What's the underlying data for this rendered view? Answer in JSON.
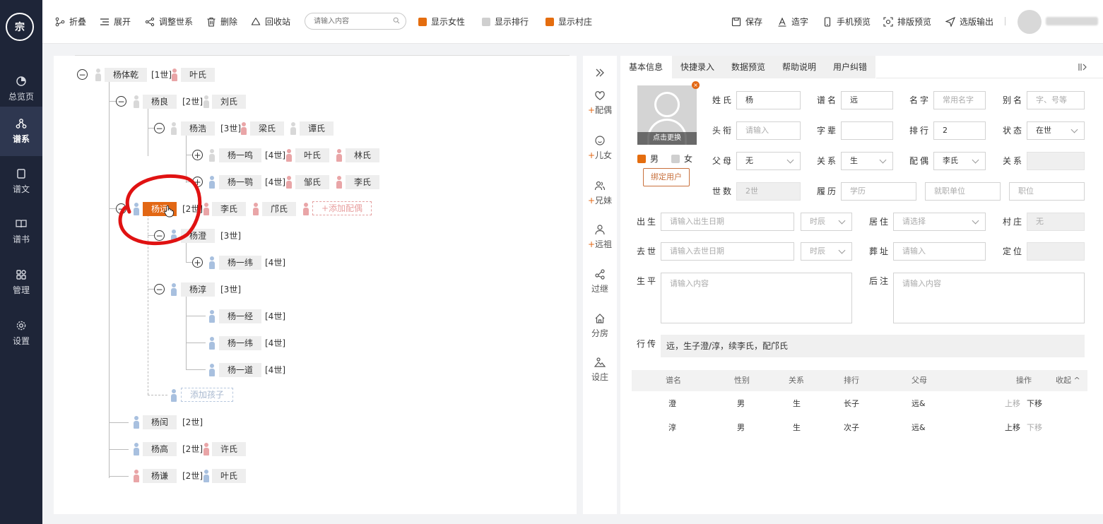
{
  "nav": {
    "logo": "宗",
    "items": [
      {
        "label": "总览页",
        "icon": "pie-icon"
      },
      {
        "label": "谱系",
        "icon": "hierarchy-icon",
        "active": true
      },
      {
        "label": "谱文",
        "icon": "doc-icon"
      },
      {
        "label": "谱书",
        "icon": "book-icon"
      },
      {
        "label": "管理",
        "icon": "grid-icon"
      },
      {
        "label": "设置",
        "icon": "gear-icon"
      }
    ]
  },
  "toolbar": {
    "collapse": "折叠",
    "expand": "展开",
    "adjust": "调整世系",
    "delete": "删除",
    "recycle": "回收站",
    "search_placeholder": "请输入内容",
    "show_female": "显示女性",
    "show_rank": "显示排行",
    "show_village": "显示村庄",
    "save": "保存",
    "make_char": "造字",
    "mobile_preview": "手机预览",
    "layout_preview": "排版预览",
    "select_output": "选版输出"
  },
  "tree": {
    "n1": {
      "name": "杨体乾",
      "gen": "[1世]",
      "spouse": "叶氏"
    },
    "n2a": {
      "name": "杨良",
      "gen": "[2世]",
      "spouse": "刘氏"
    },
    "n3a": {
      "name": "杨浩",
      "gen": "[3世]",
      "spouse1": "梁氏",
      "spouse2": "谭氏"
    },
    "n4a": {
      "name": "杨一鸣",
      "gen": "[4世]",
      "spouse1": "叶氏",
      "spouse2": "林氏"
    },
    "n4b": {
      "name": "杨一鹗",
      "gen": "[4世]",
      "spouse1": "邹氏",
      "spouse2": "李氏"
    },
    "n2b": {
      "name": "杨远",
      "gen": "[2世]",
      "spouse1": "李氏",
      "spouse2": "邝氏",
      "add_spouse": "+添加配偶"
    },
    "n3b": {
      "name": "杨澄",
      "gen": "[3世]"
    },
    "n4c": {
      "name": "杨一纬",
      "gen": "[4世]"
    },
    "n3c": {
      "name": "杨淳",
      "gen": "[3世]"
    },
    "n4d": {
      "name": "杨一经",
      "gen": "[4世]"
    },
    "n4e": {
      "name": "杨一纬",
      "gen": "[4世]"
    },
    "n4f": {
      "name": "杨一道",
      "gen": "[4世]"
    },
    "add_child": "添加孩子",
    "n2c": {
      "name": "杨闰",
      "gen": "[2世]"
    },
    "n2d": {
      "name": "杨高",
      "gen": "[2世]",
      "spouse": "许氏"
    },
    "n2e": {
      "name": "杨谦",
      "gen": "[2世]",
      "spouse": "叶氏"
    }
  },
  "actions": [
    {
      "plus": "+",
      "label": "配偶",
      "icon": "spouse-icon"
    },
    {
      "plus": "+",
      "label": "儿女",
      "icon": "child-icon"
    },
    {
      "plus": "+",
      "label": "兄妹",
      "icon": "siblings-icon"
    },
    {
      "plus": "+",
      "label": "远祖",
      "icon": "ancestor-icon"
    },
    {
      "plus": "",
      "label": "过继",
      "icon": "adopt-icon"
    },
    {
      "plus": "",
      "label": "分房",
      "icon": "house-icon"
    },
    {
      "plus": "",
      "label": "设庄",
      "icon": "village-icon"
    }
  ],
  "tabs": [
    "基本信息",
    "快捷录入",
    "数据预览",
    "帮助说明",
    "用户纠错"
  ],
  "form": {
    "photo_caption": "点击更换",
    "photo_remove": "×",
    "male": "男",
    "female": "女",
    "bind_user": "绑定用户",
    "surname_label": "姓氏",
    "surname": "杨",
    "puming_label": "谱名",
    "puming": "远",
    "mingzi_label": "名字",
    "mingzi_ph": "常用名字",
    "bieming_label": "别名",
    "bieming_ph": "字、号等",
    "touxian_label": "头衔",
    "touxian_ph": "请输入",
    "zibei_label": "字辈",
    "zibei": "",
    "paihang_label": "排行",
    "paihang": "2",
    "status_label": "状态",
    "status": "在世",
    "fumu_label": "父母",
    "fumu": "无",
    "guanxi_label": "关系",
    "guanxi": "生",
    "peiou_label": "配偶",
    "peiou": "李氏",
    "guanxi2_label": "关系",
    "guanxi2": "",
    "shishu_label": "世数",
    "shishu": "2世",
    "lvli_label": "履历",
    "lvli_ph": "学历",
    "danwei_ph": "就职单位",
    "zhiwei_ph": "职位",
    "birth_label": "出生",
    "birth_ph": "请输入出生日期",
    "birth_time": "时辰",
    "live_label": "居住",
    "live_ph": "请选择",
    "village_label": "村庄",
    "village": "无",
    "death_label": "去世",
    "death_ph": "请输入去世日期",
    "death_time": "时辰",
    "burial_label": "葬址",
    "burial_ph": "请输入",
    "locate_label": "定位",
    "locate": "",
    "life_label": "生平",
    "life_ph": "请输入内容",
    "note_label": "后注",
    "note_ph": "请输入内容",
    "bio_label": "行传",
    "bio": "远，生子澄/淳，续李氏，配邝氏"
  },
  "table": {
    "headers": [
      "谱名",
      "性别",
      "关系",
      "排行",
      "父母",
      "操作",
      "收起 ^"
    ],
    "rows": [
      {
        "name": "澄",
        "sex": "男",
        "rel": "生",
        "rank": "长子",
        "parent": "远&",
        "up": "上移",
        "down": "下移"
      },
      {
        "name": "淳",
        "sex": "男",
        "rel": "生",
        "rank": "次子",
        "parent": "远&",
        "up": "上移",
        "down": "下移"
      }
    ]
  },
  "colors": {
    "accent": "#e26714",
    "nav_bg": "#1e2538"
  }
}
